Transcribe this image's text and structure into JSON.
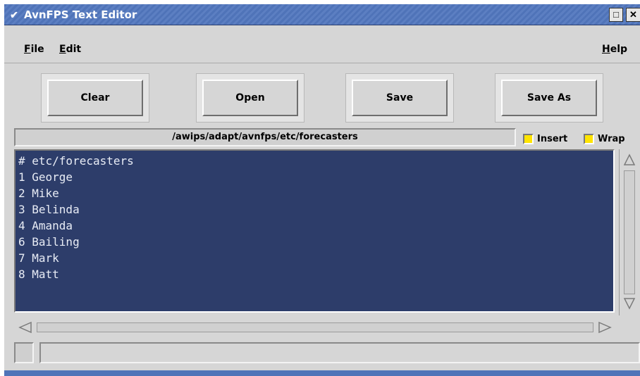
{
  "window": {
    "title": "AvnFPS Text Editor",
    "menu_icon": "chevron-down-icon",
    "maximize_icon": "□",
    "close_icon": "✕"
  },
  "menubar": {
    "file": {
      "mnemonic": "F",
      "rest": "ile"
    },
    "edit": {
      "mnemonic": "E",
      "rest": "dit"
    },
    "help": {
      "mnemonic": "H",
      "rest": "elp"
    }
  },
  "toolbar": {
    "clear": "Clear",
    "open": "Open",
    "save": "Save",
    "save_as": "Save As"
  },
  "path": "/awips/adapt/avnfps/etc/forecasters",
  "options": {
    "insert": {
      "label": "Insert",
      "checked": true
    },
    "wrap": {
      "label": "Wrap",
      "checked": true
    }
  },
  "editor": {
    "lines": [
      "# etc/forecasters",
      "1 George",
      "2 Mike",
      "3 Belinda",
      "4 Amanda",
      "6 Bailing",
      "7 Mark",
      "8 Matt"
    ]
  },
  "status": {
    "text": ""
  },
  "colors": {
    "titlebar": "#4f73b8",
    "editor_bg": "#2d3d6a",
    "editor_text": "#e8ecf5",
    "checkbox": "#ffe400"
  }
}
